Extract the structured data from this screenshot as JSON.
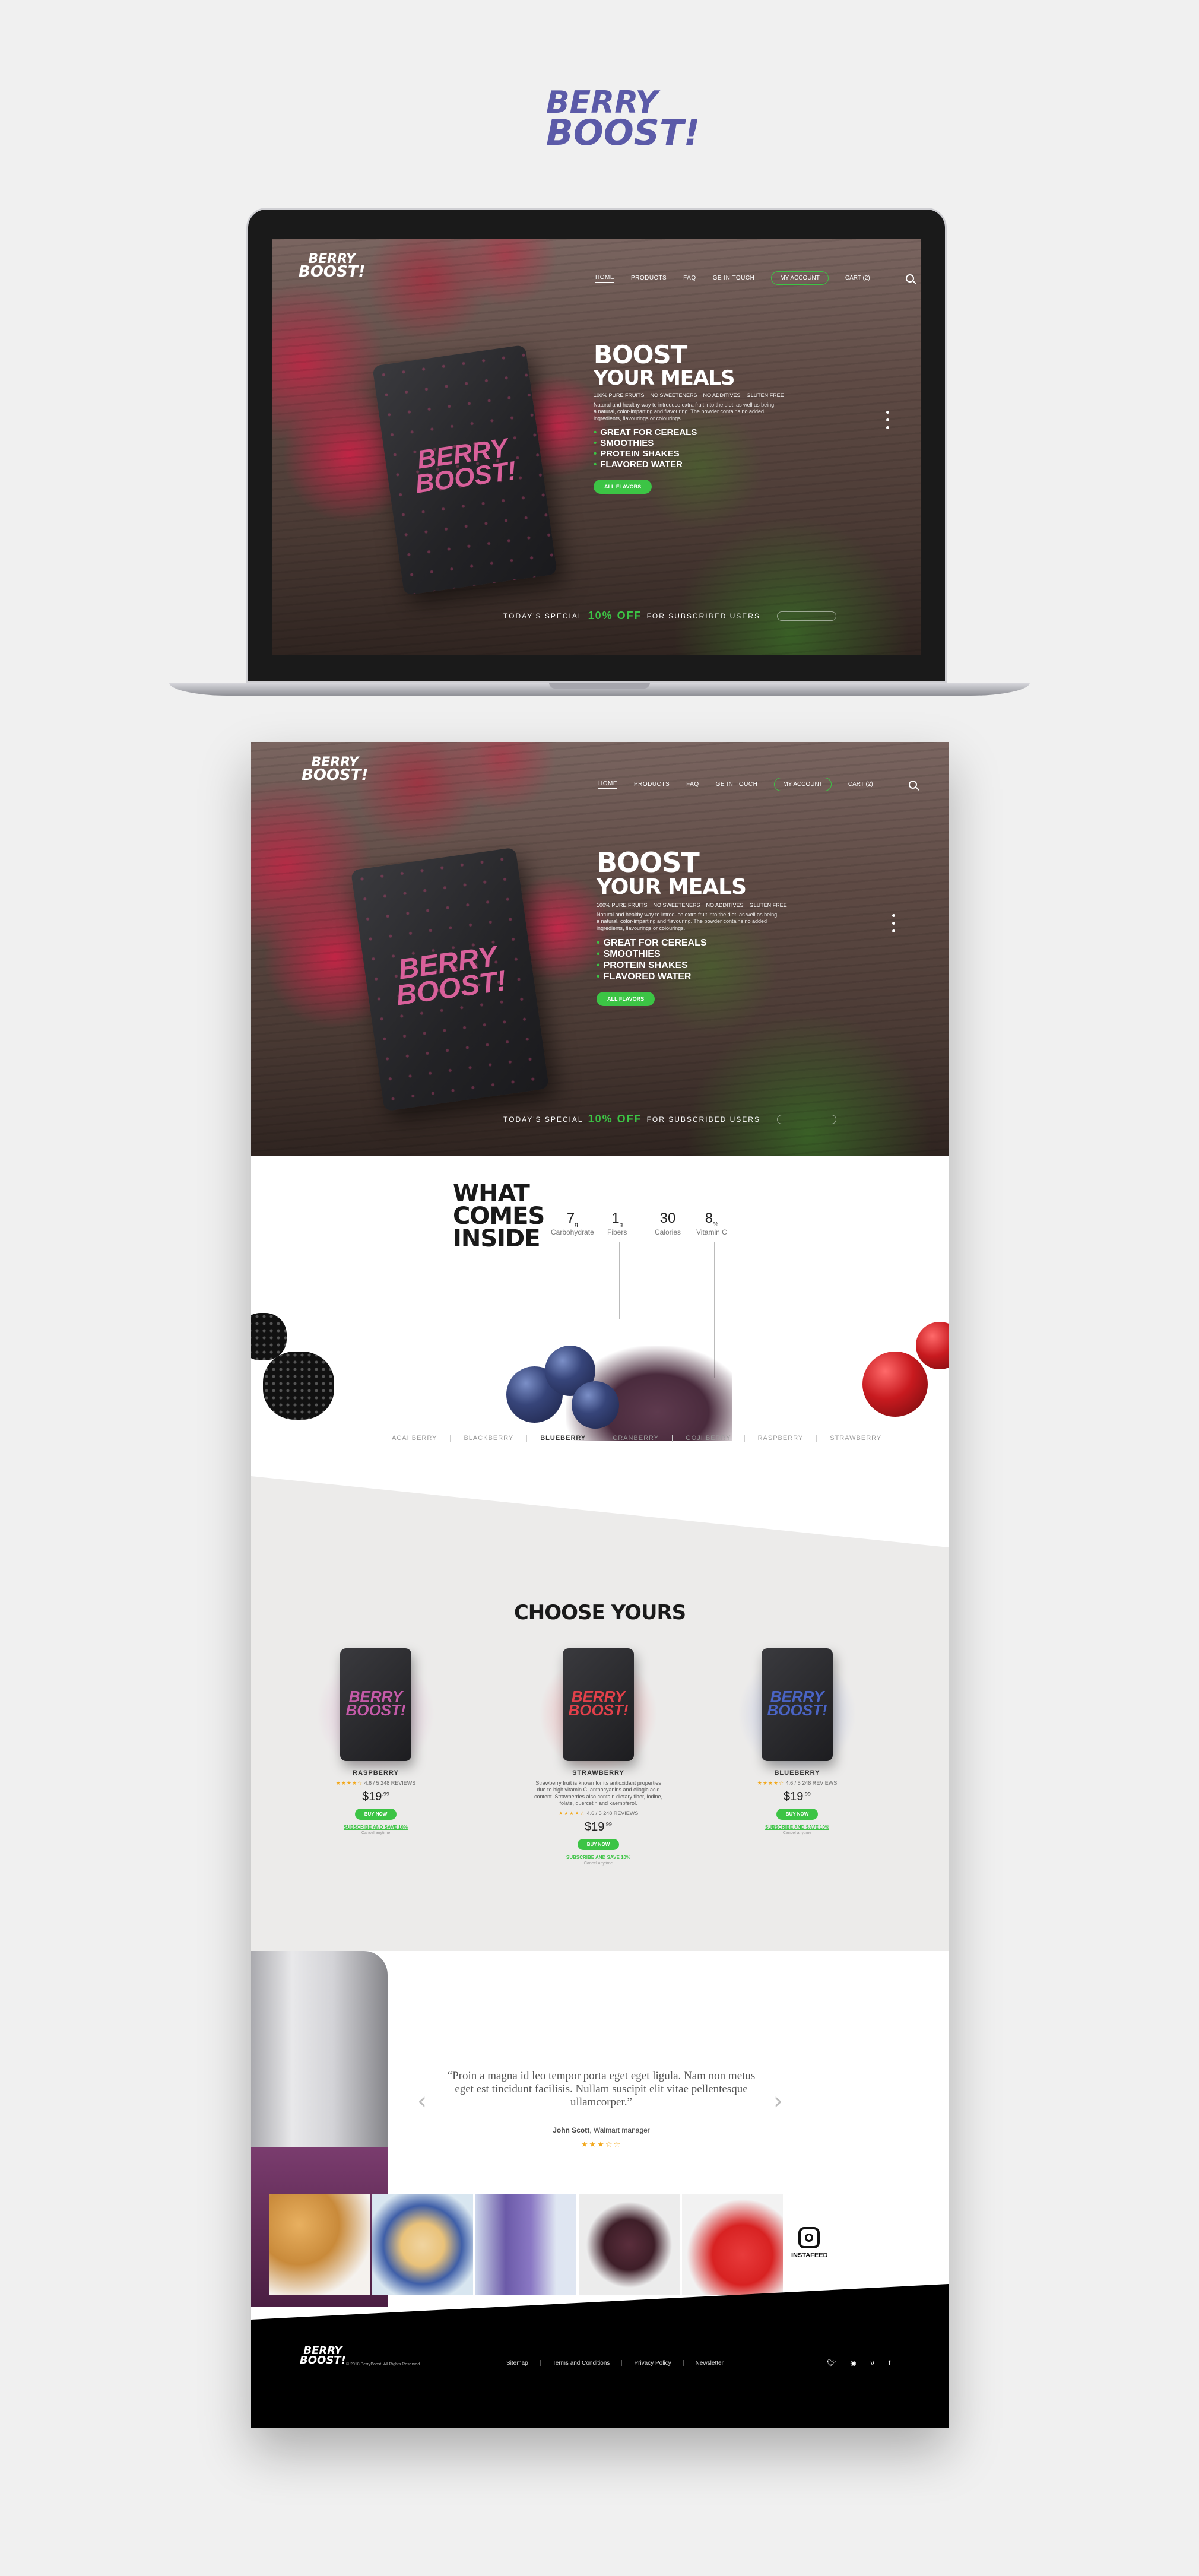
{
  "brand": {
    "logo_line1": "BERRY",
    "logo_line2": "BOOST!",
    "accent_color": "#3cc445"
  },
  "nav": {
    "items": [
      "HOME",
      "PRODUCTS",
      "FAQ",
      "GE IN TOUCH"
    ],
    "account": "MY ACCOUNT",
    "cart": "CART (2)",
    "search_icon": "search-icon"
  },
  "hero": {
    "title_line1": "BOOST",
    "title_line2": "YOUR MEALS",
    "tags": [
      "100% PURE FRUITS",
      "NO SWEETENERS",
      "NO ADDITIVES",
      "GLUTEN FREE"
    ],
    "description": "Natural and healthy way to introduce extra fruit into the diet, as well as being a natural, color-imparting and flavouring. The powder contains no added ingredients, flavourings or colourings.",
    "benefits": [
      "GREAT FOR CEREALS",
      "SMOOTHIES",
      "PROTEIN SHAKES",
      "FLAVORED WATER"
    ],
    "cta": "ALL FLAVORS",
    "special_prefix": "TODAY'S SPECIAL",
    "special_off": "10% OFF",
    "special_suffix": "FOR SUBSCRIBED USERS"
  },
  "inside": {
    "title_line1": "WHAT",
    "title_line2": "COMES",
    "title_line3": "INSIDE",
    "stats": [
      {
        "value": "7",
        "unit": "g",
        "label": "Carbohydrate"
      },
      {
        "value": "1",
        "unit": "g",
        "label": "Fibers"
      },
      {
        "value": "30",
        "unit": "",
        "label": "Calories"
      },
      {
        "value": "8",
        "unit": "%",
        "label": "Vitamin C"
      }
    ],
    "tabs": [
      "ACAI BERRY",
      "BLACKBERRY",
      "BLUEBERRY",
      "CRANBERRY",
      "GOJI BERRY",
      "RASPBERRY",
      "STRAWBERRY"
    ],
    "active_tab": "BLUEBERRY"
  },
  "choose": {
    "title": "CHOOSE YOURS",
    "products": [
      {
        "name": "RASPBERRY",
        "desc": "",
        "rating": "4.6 / 5",
        "reviews": "248 REVIEWS",
        "price": "19",
        "cents": ".99",
        "buy": "BUY NOW",
        "subscribe": "SUBSCRIBE AND SAVE 10%",
        "subnote": "Cancel anytime",
        "color": "#c45aa8"
      },
      {
        "name": "STRAWBERRY",
        "desc": "Strawberry fruit is known for its antioxidant properties due to high vitamin C, anthocyanins and ellagic acid content. Strawberries also contain dietary fiber, iodine, folate, quercetin and kaempferol.",
        "rating": "4.6 / 5",
        "reviews": "248 REVIEWS",
        "price": "19",
        "cents": ".99",
        "buy": "BUY NOW",
        "subscribe": "SUBSCRIBE AND SAVE 10%",
        "subnote": "Cancel anytime",
        "color": "#e2404a"
      },
      {
        "name": "BLUEBERRY",
        "desc": "",
        "rating": "4.6 / 5",
        "reviews": "248 REVIEWS",
        "price": "19",
        "cents": ".99",
        "buy": "BUY NOW",
        "subscribe": "SUBSCRIBE AND SAVE 10%",
        "subnote": "Cancel anytime",
        "color": "#4a64c4"
      }
    ]
  },
  "testimonial": {
    "quote": "“Proin a magna id leo tempor porta eget eget ligula. Nam non metus eget est tincidunt facilisis. Nullam suscipit elit vitae pellentesque ullamcorper.”",
    "author": "John Scott",
    "role": ", Walmart manager",
    "stars": "★★★☆☆",
    "insta_label": "INSTAFEED"
  },
  "footer": {
    "copyright": "© 2018 BerryBoost. All Rights Reserved.",
    "links": [
      "Sitemap",
      "Terms and Conditions",
      "Privacy Policy",
      "Newsletter"
    ],
    "socials": [
      "twitter-icon",
      "pinterest-icon",
      "vimeo-icon",
      "facebook-icon"
    ]
  }
}
